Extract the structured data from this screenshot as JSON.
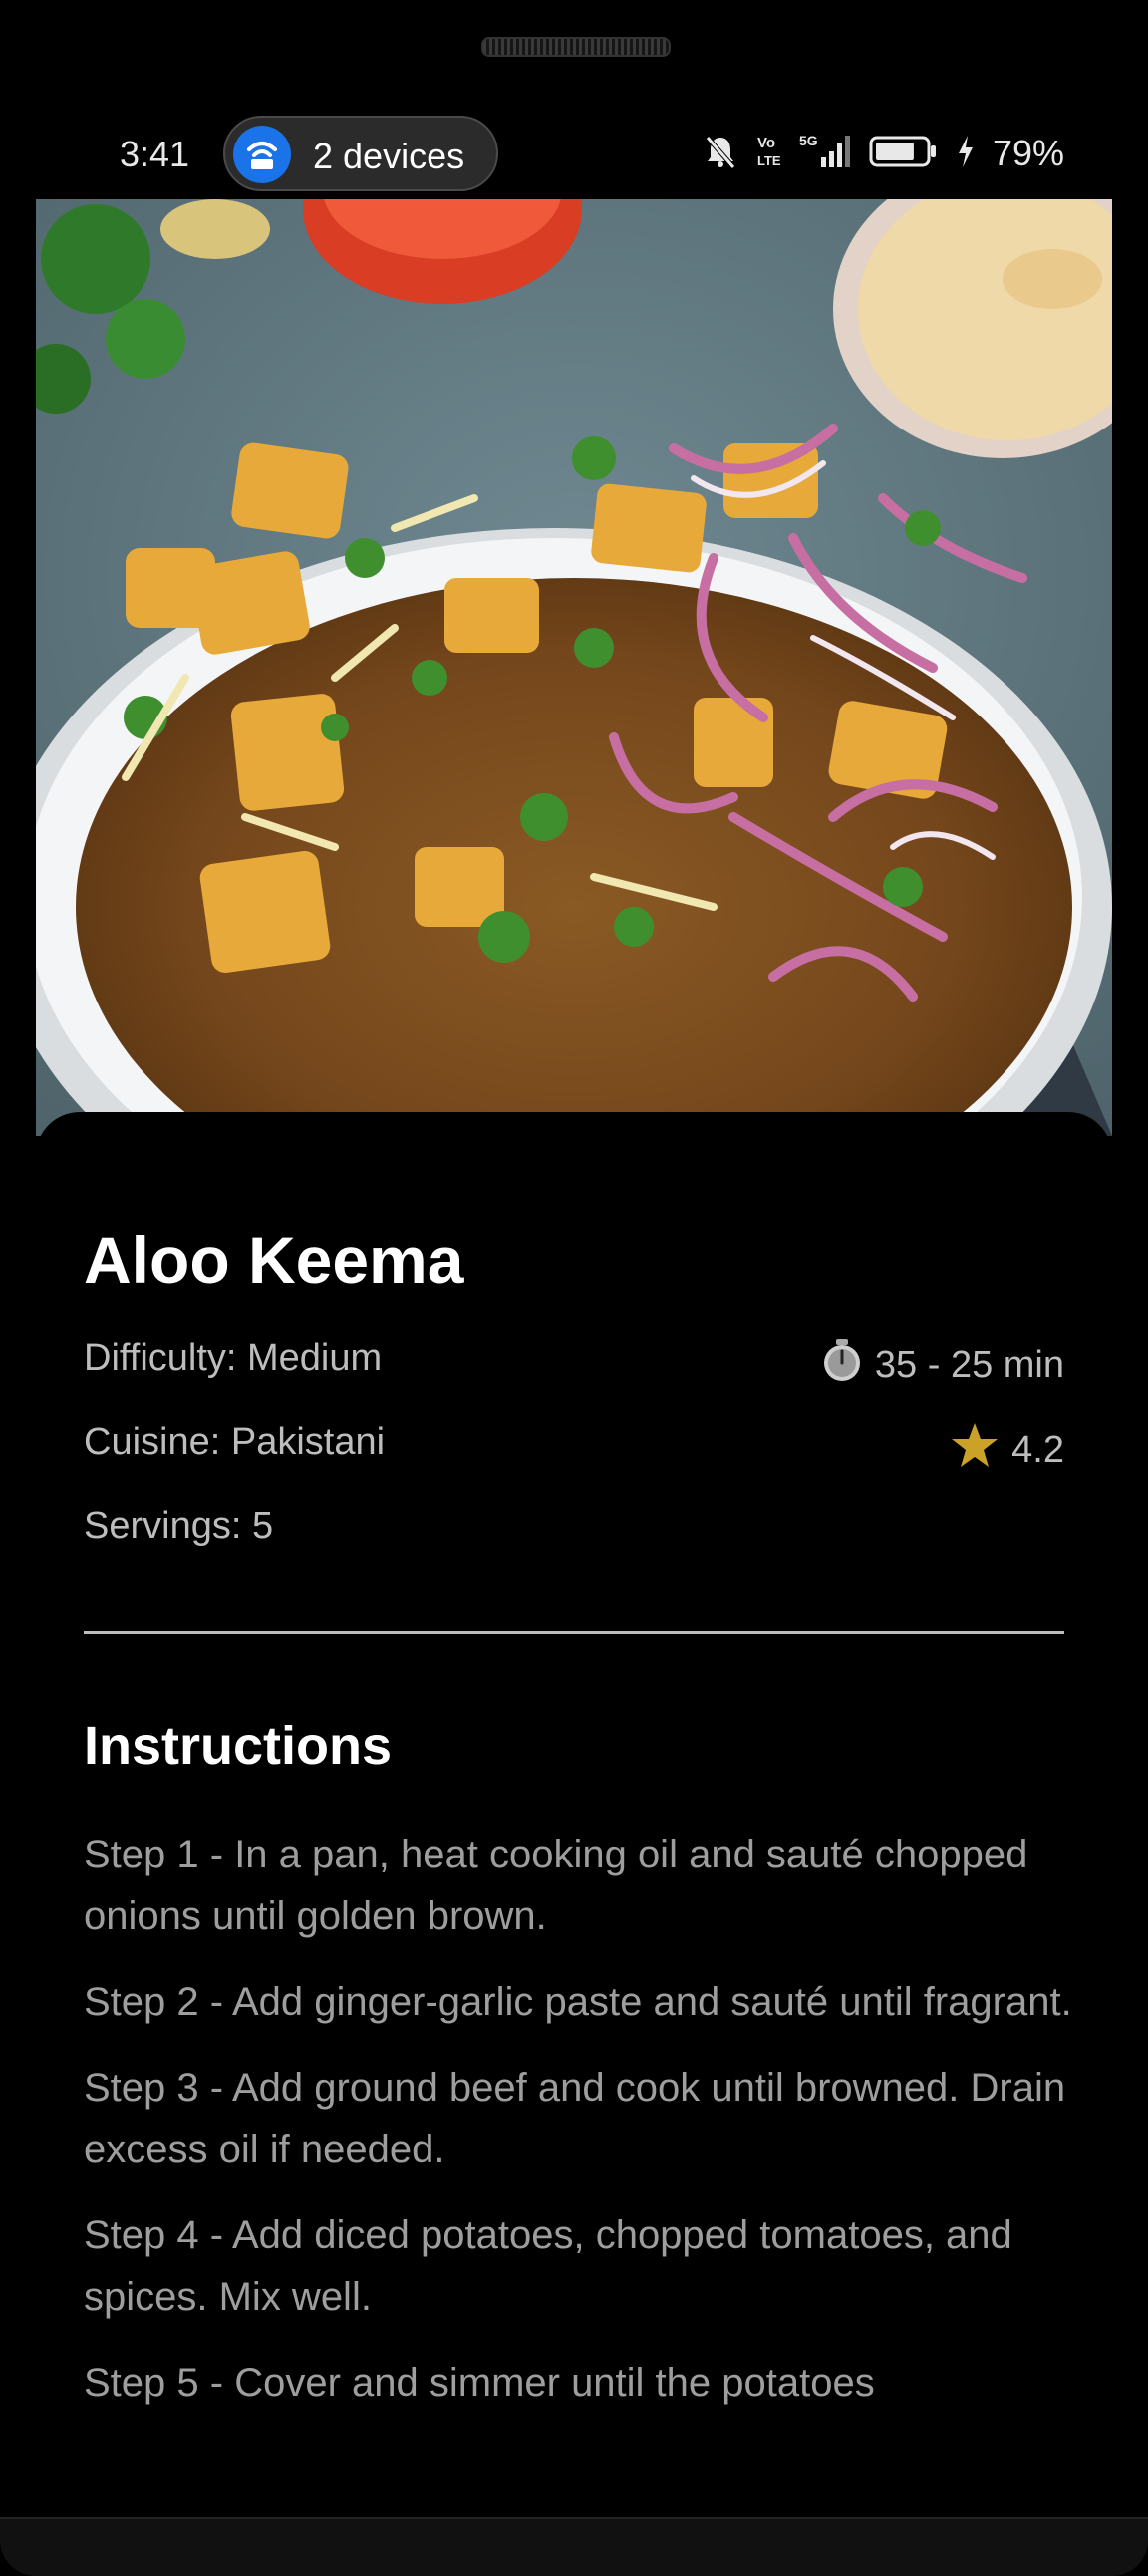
{
  "status_bar": {
    "time": "3:41",
    "hotspot_label": "2 devices",
    "network_label": "5G",
    "volte_label": "Vo LTE",
    "battery_percent": "79%",
    "battery_level": 0.79,
    "icons": [
      "hotspot-icon",
      "bell-off-icon",
      "volte-icon",
      "signal-icon",
      "battery-icon",
      "charging-icon"
    ]
  },
  "recipe": {
    "image_alt": "Aloo Keema dish photo",
    "title": "Aloo Keema",
    "difficulty": "Difficulty: Medium",
    "cuisine": "Cuisine: Pakistani",
    "servings": "Servings: 5",
    "time": "35 - 25 min",
    "rating": "4.2",
    "timer_icon": "timer-icon",
    "rating_icon": "star-icon",
    "star_color": "#c9a227"
  },
  "instructions": {
    "heading": "Instructions",
    "steps": [
      "Step 1 - In a pan, heat cooking oil and sauté chopped onions until golden brown.",
      "Step 2 - Add ginger-garlic paste and sauté until fragrant.",
      "Step 3 - Add ground beef and cook until browned. Drain excess oil if needed.",
      "Step 4 - Add diced potatoes, chopped tomatoes, and spices. Mix well.",
      "Step 5 - Cover and simmer until the potatoes"
    ]
  }
}
